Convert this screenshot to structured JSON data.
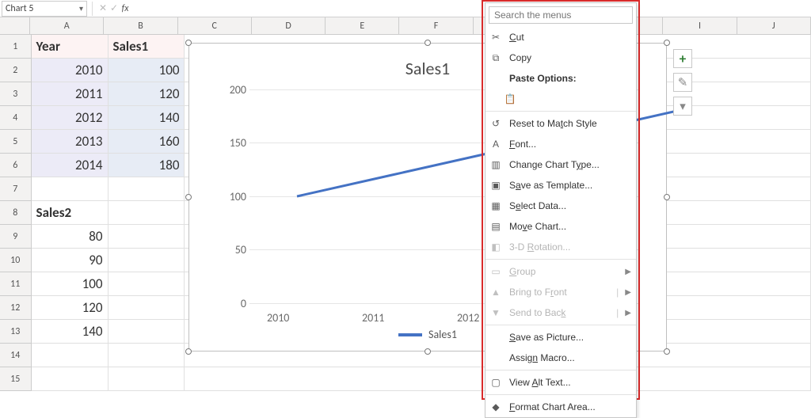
{
  "formula_bar": {
    "name_box_value": "Chart 5",
    "cancel_icon": "✕",
    "confirm_icon": "✓",
    "fx_label": "fx",
    "formula_value": ""
  },
  "columns": [
    "A",
    "B",
    "C",
    "D",
    "E",
    "F",
    "I",
    "J"
  ],
  "row_headers": [
    "1",
    "2",
    "3",
    "4",
    "5",
    "6",
    "7",
    "8",
    "9",
    "10",
    "11",
    "12",
    "13",
    "14",
    "15"
  ],
  "sheet": {
    "a1": "Year",
    "b1": "Sales1",
    "a2": "2010",
    "b2": "100",
    "a3": "2011",
    "b3": "120",
    "a4": "2012",
    "b4": "140",
    "a5": "2013",
    "b5": "160",
    "a6": "2014",
    "b6": "180",
    "a8": "Sales2",
    "a9": "80",
    "a10": "90",
    "a11": "100",
    "a12": "120",
    "a13": "140"
  },
  "chart_data": {
    "type": "line",
    "title": "Sales1",
    "categories": [
      "2010",
      "2011",
      "2012",
      "2013",
      "2014"
    ],
    "series": [
      {
        "name": "Sales1",
        "values": [
          100,
          120,
          140,
          160,
          180
        ]
      }
    ],
    "yticks": [
      0,
      50,
      100,
      150,
      200
    ],
    "visible_xticks": [
      "2010",
      "2011",
      "2012"
    ],
    "ylim": [
      0,
      200
    ],
    "legend_position": "bottom"
  },
  "side_buttons": {
    "plus": "+",
    "brush": "✎",
    "filter": "▾"
  },
  "context_menu": {
    "search_placeholder": "Search the menus",
    "cut": "Cut",
    "copy": "Copy",
    "paste_options_label": "Paste Options:",
    "reset_match": "Reset to Match Style",
    "font": "Font...",
    "change_chart_type": "Change Chart Type...",
    "save_as_template": "Save as Template...",
    "select_data": "Select Data...",
    "move_chart": "Move Chart...",
    "three_d": "3-D Rotation...",
    "group": "Group",
    "bring_front": "Bring to Front",
    "send_back": "Send to Back",
    "save_pic": "Save as Picture...",
    "assign_macro": "Assign Macro...",
    "alt_text": "View Alt Text...",
    "format_chart_area": "Format Chart Area..."
  }
}
